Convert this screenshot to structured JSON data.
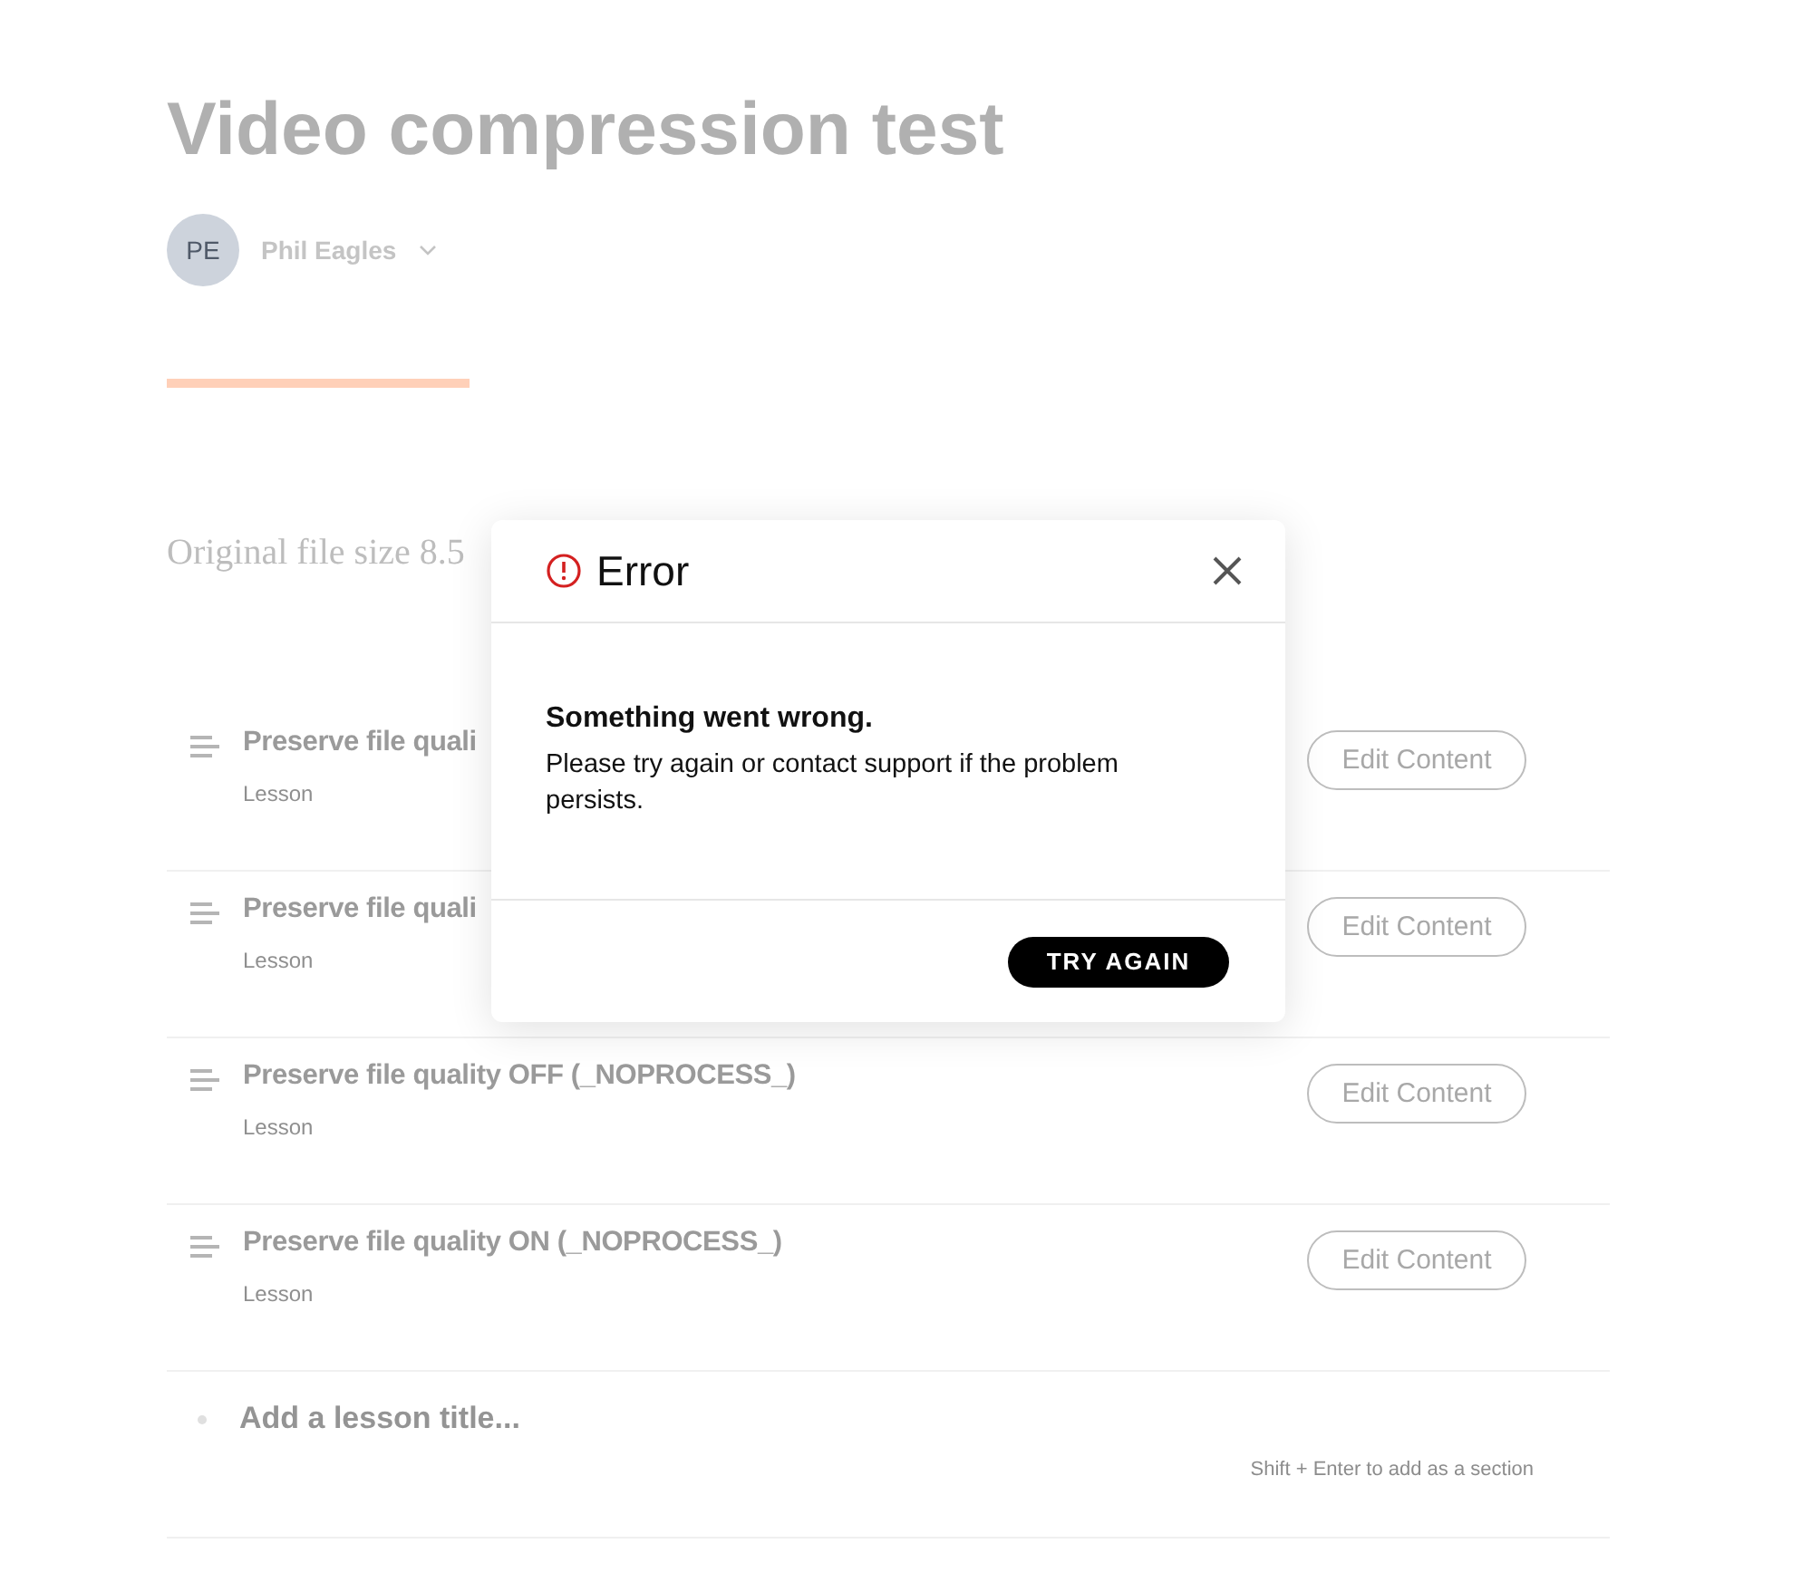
{
  "course": {
    "title": "Video compression test",
    "author": {
      "initials": "PE",
      "name": "Phil Eagles"
    },
    "progress": {
      "level": 0.21
    },
    "description": "Original file size 8.5"
  },
  "lessons": [
    {
      "title": "Preserve file quali",
      "type": "Lesson",
      "button": "Edit Content"
    },
    {
      "title": "Preserve file quali",
      "type": "Lesson",
      "button": "Edit Content"
    },
    {
      "title": "Preserve file quality OFF (_NOPROCESS_)",
      "type": "Lesson",
      "button": "Edit Content"
    },
    {
      "title": "Preserve file quality ON (_NOPROCESS_)",
      "type": "Lesson",
      "button": "Edit Content"
    }
  ],
  "new_lesson": {
    "placeholder": "Add a lesson title...",
    "hint": "Shift + Enter to add as a section"
  },
  "dialog": {
    "title": "Error",
    "heading": "Something went wrong.",
    "message": "Please try again or contact support if the problem persists.",
    "button": "TRY AGAIN"
  }
}
